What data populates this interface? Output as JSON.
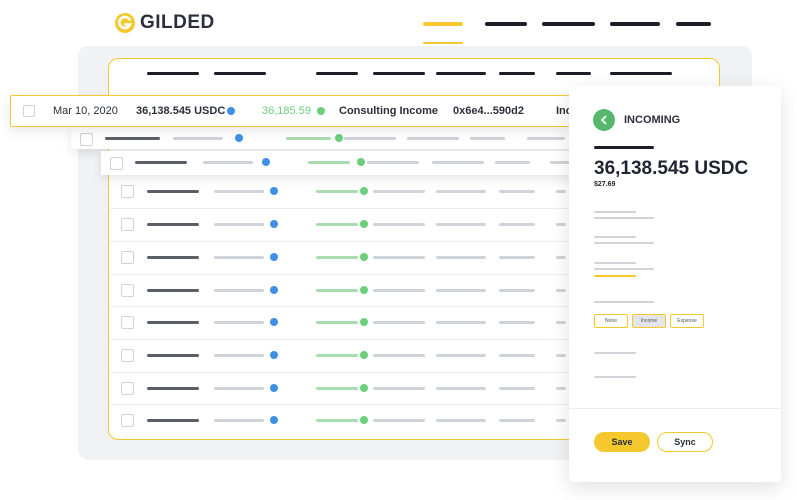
{
  "brand": {
    "name": "GILDED"
  },
  "transaction": {
    "date": "Mar 10, 2020",
    "amount": "36,138.545 USDC",
    "fiat_value": "36,185.59",
    "category": "Consulting Income",
    "hash": "0x6e4...590d2",
    "type_truncated": "Inc"
  },
  "detail_panel": {
    "title": "INCOMING",
    "amount": "36,138.545 USDC",
    "fiat": "$27.69",
    "tags": [
      "None",
      "Income",
      "Expense"
    ],
    "selected_tag": "Income",
    "save_label": "Save",
    "sync_label": "Sync"
  },
  "colors": {
    "accent": "#f5c92e",
    "green": "#56b86a",
    "blue": "#3f8fe6",
    "text": "#1f2430"
  },
  "icons": [
    "gilded-logo-icon",
    "back-arrow-icon",
    "checkbox-icon",
    "status-dot-icon"
  ]
}
